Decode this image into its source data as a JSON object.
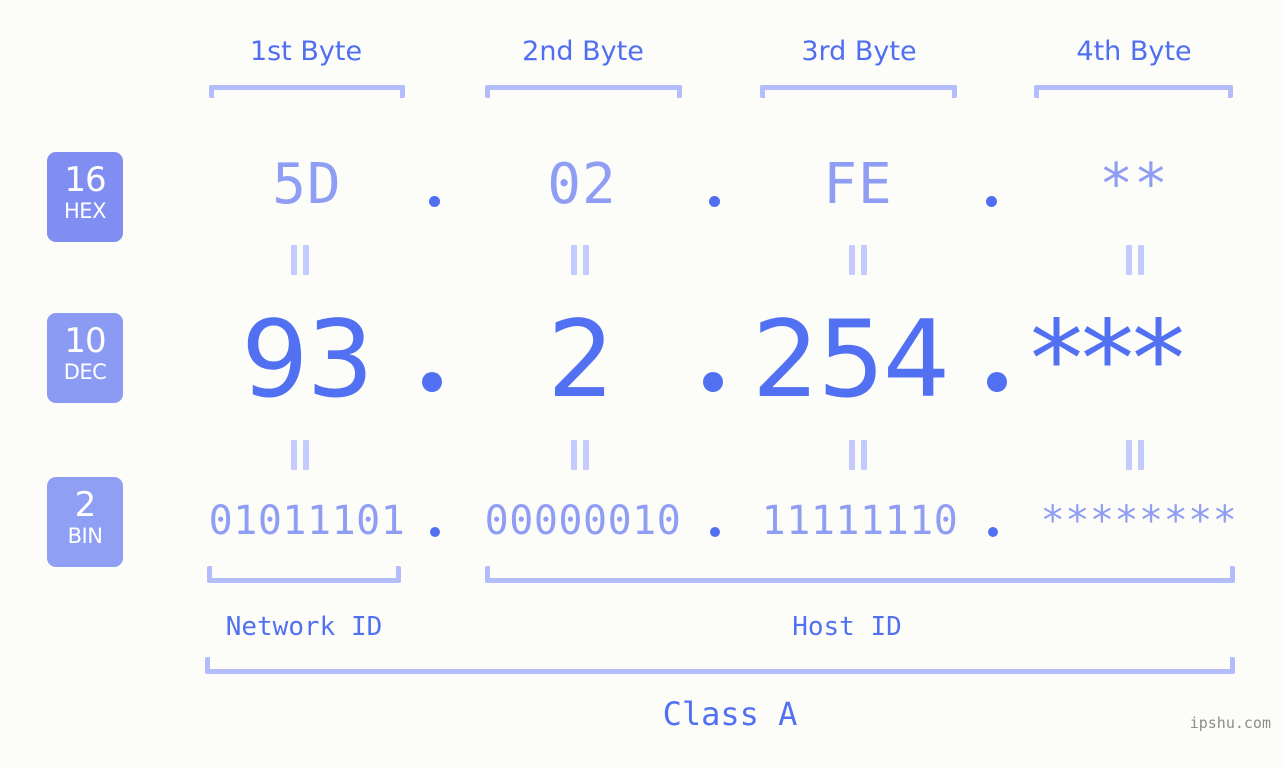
{
  "title": "IP address byte breakdown",
  "colors": {
    "background": "#fcfdf9",
    "accent_strong": "#5271f2",
    "accent_light": "#8f9ef4",
    "bracket": "#b4bdfb",
    "badge": "#7f8ef0",
    "watermark": "#8c8c8c"
  },
  "byte_headers": [
    {
      "label": "1st Byte"
    },
    {
      "label": "2nd Byte"
    },
    {
      "label": "3rd Byte"
    },
    {
      "label": "4th Byte"
    }
  ],
  "bases": [
    {
      "number": "16",
      "name": "HEX"
    },
    {
      "number": "10",
      "name": "DEC"
    },
    {
      "number": "2",
      "name": "BIN"
    }
  ],
  "rows": {
    "hex": {
      "base": "16",
      "name": "HEX",
      "values": [
        "5D",
        "02",
        "FE",
        "**"
      ],
      "separator": "."
    },
    "dec": {
      "base": "10",
      "name": "DEC",
      "values": [
        "93",
        "2",
        "254",
        "***"
      ],
      "separator": "."
    },
    "bin": {
      "base": "2",
      "name": "BIN",
      "values": [
        "01011101",
        "00000010",
        "11111110",
        "********"
      ],
      "separator": "."
    }
  },
  "equals_marks": {
    "symbol": "=",
    "count_per_gap": 4
  },
  "segments": {
    "network_id": "Network ID",
    "host_id": "Host ID"
  },
  "class": {
    "label": "Class A"
  },
  "watermark": {
    "text": "ipshu.com"
  }
}
